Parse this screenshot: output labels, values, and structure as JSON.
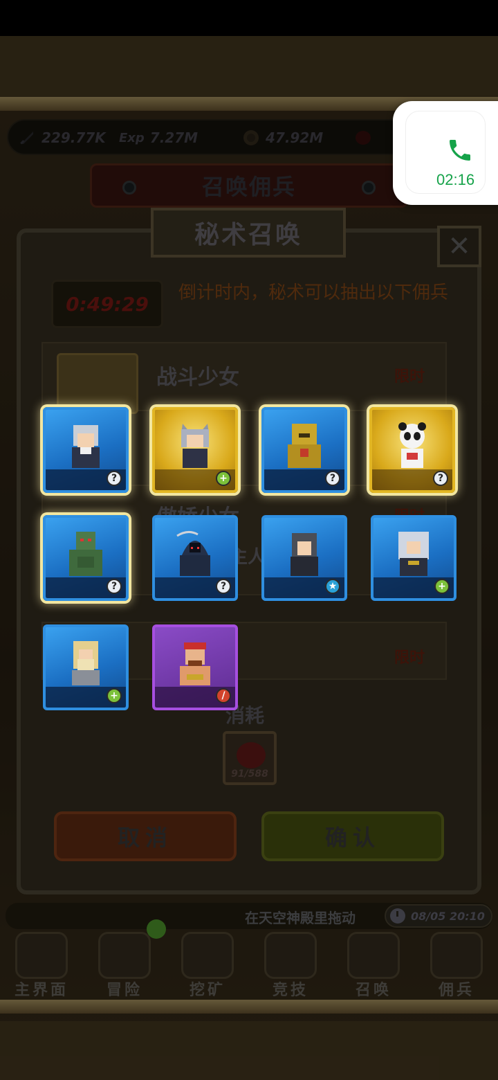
{
  "resources": {
    "attack": "229.77K",
    "exp_label": "Exp",
    "exp": "7.27M",
    "coins": "47.92M"
  },
  "summon_banner": "召唤佣兵",
  "popup": {
    "title": "秘术召唤",
    "close": "✕",
    "timer": "0:49:29",
    "tip": "倒计时内，秘术可以抽出以下佣兵",
    "rows": [
      {
        "name": "战斗少女",
        "tag": "限时"
      },
      {
        "name": "傲娇少女",
        "tag": "限时",
        "subtext": "主人 · 狂欢"
      },
      {
        "name": "",
        "tag": "限时"
      }
    ],
    "cost_label": "消耗",
    "cost_count": "91/588",
    "cancel": "取消",
    "confirm": "确认"
  },
  "heroes": [
    {
      "id": "silver-haired-swordsman",
      "rarity": "blue",
      "badge": "question",
      "selected": true
    },
    {
      "id": "cat-eared-girl",
      "rarity": "gold",
      "badge": "plus",
      "selected": true
    },
    {
      "id": "golden-armor-knight",
      "rarity": "blue",
      "badge": "question",
      "selected": true
    },
    {
      "id": "panda",
      "rarity": "gold",
      "badge": "question",
      "selected": true
    },
    {
      "id": "green-robot",
      "rarity": "blue",
      "badge": "question",
      "selected": true
    },
    {
      "id": "hooded-reaper",
      "rarity": "blue",
      "badge": "question",
      "selected": false
    },
    {
      "id": "dark-haired-swordsman",
      "rarity": "blue",
      "badge": "star",
      "selected": false
    },
    {
      "id": "white-haired-elder",
      "rarity": "blue",
      "badge": "plus",
      "selected": false
    },
    {
      "id": "bearded-sage",
      "rarity": "blue",
      "badge": "plus",
      "selected": false
    },
    {
      "id": "bandana-warrior",
      "rarity": "purple",
      "badge": "sword",
      "selected": false
    }
  ],
  "bottom": {
    "hint": "在天空神殿里拖动",
    "datetime": "08/05 20:10"
  },
  "nav": [
    {
      "label": "主界面",
      "icon": "map-scroll-icon"
    },
    {
      "label": "冒险",
      "icon": "island-icon"
    },
    {
      "label": "挖矿",
      "icon": "pickaxe-icon"
    },
    {
      "label": "竞技",
      "icon": "crossed-swords-icon"
    },
    {
      "label": "召唤",
      "icon": "summon-scroll-icon"
    },
    {
      "label": "佣兵",
      "icon": "tent-icon"
    }
  ],
  "call": {
    "time": "02:16",
    "color": "#16a34a"
  }
}
